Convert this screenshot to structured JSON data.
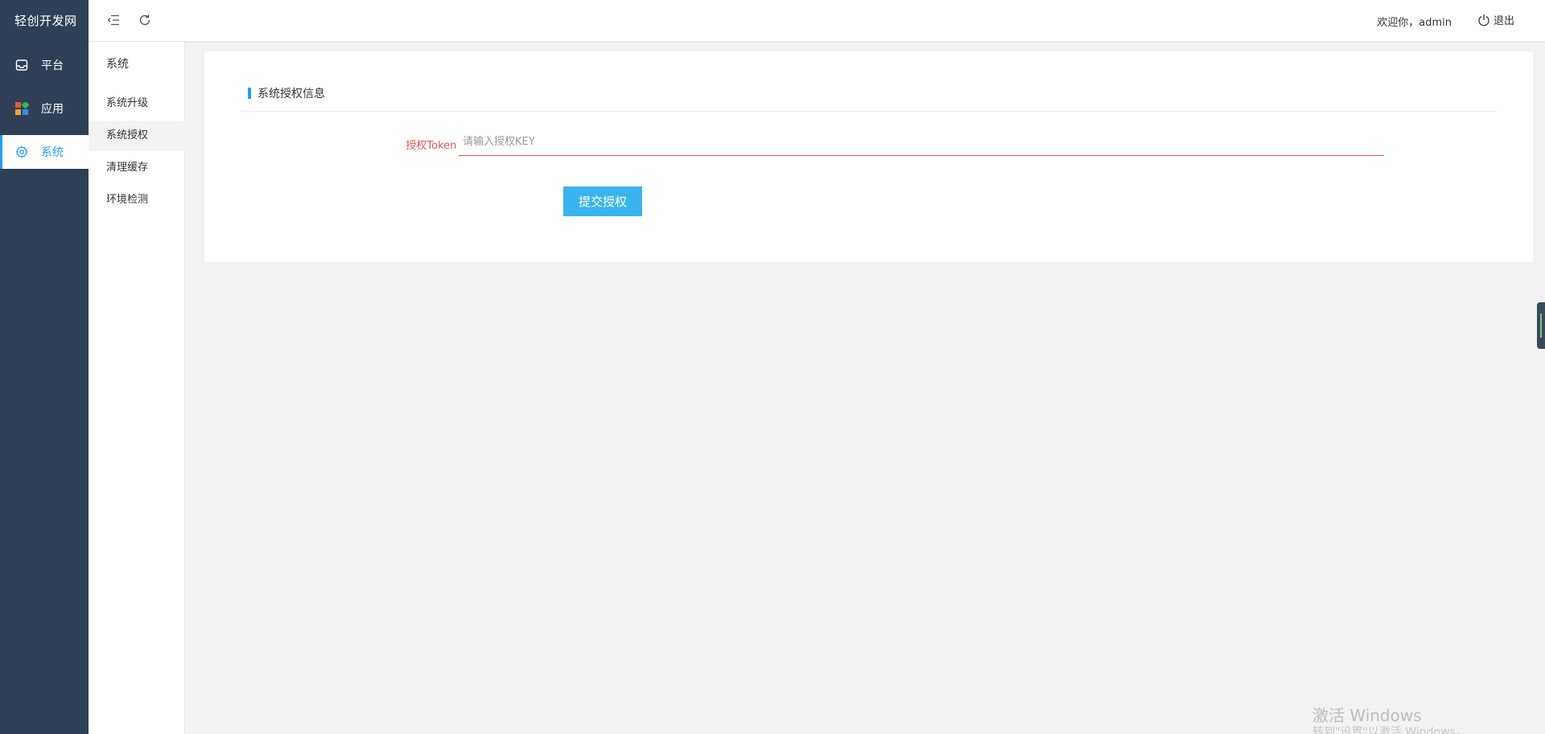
{
  "brand": "轻创开发网",
  "sidebar": {
    "items": [
      {
        "label": "平台",
        "icon": "platform-icon"
      },
      {
        "label": "应用",
        "icon": "apps-grid-icon"
      },
      {
        "label": "系统",
        "icon": "gear-icon",
        "active": true
      }
    ]
  },
  "submenu": {
    "title": "系统",
    "items": [
      {
        "label": "系统升级"
      },
      {
        "label": "系统授权",
        "active": true
      },
      {
        "label": "清理缓存"
      },
      {
        "label": "环境检测"
      }
    ]
  },
  "header": {
    "collapse_icon": "menu-fold-icon",
    "refresh_icon": "refresh-icon",
    "welcome": "欢迎你，admin",
    "logout_label": "退出"
  },
  "card": {
    "title": "系统授权信息",
    "field_label": "授权Token *",
    "input_value": "",
    "input_placeholder": "请输入授权KEY",
    "submit_label": "提交授权"
  },
  "watermark": {
    "line1": "激活 Windows",
    "line2": "转到\"设置\"以激活 Windows。"
  },
  "colors": {
    "sidebar_bg": "#2f4056",
    "accent": "#1e9fff",
    "button": "#3ab4ef",
    "error": "#e35454"
  }
}
